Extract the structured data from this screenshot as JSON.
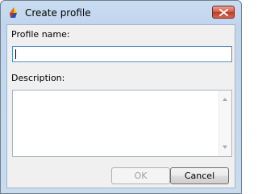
{
  "window": {
    "title": "Create profile",
    "icon": "app-logo-icon",
    "close_icon": "close-icon"
  },
  "form": {
    "profile_name_label": "Profile name:",
    "profile_name_value": "",
    "description_label": "Description:",
    "description_value": ""
  },
  "buttons": {
    "ok_label": "OK",
    "ok_enabled": false,
    "cancel_label": "Cancel"
  },
  "colors": {
    "close_button": "#c9462f",
    "input_focus_border": "#5d8fc3",
    "disabled_text": "#a0a0a0"
  }
}
